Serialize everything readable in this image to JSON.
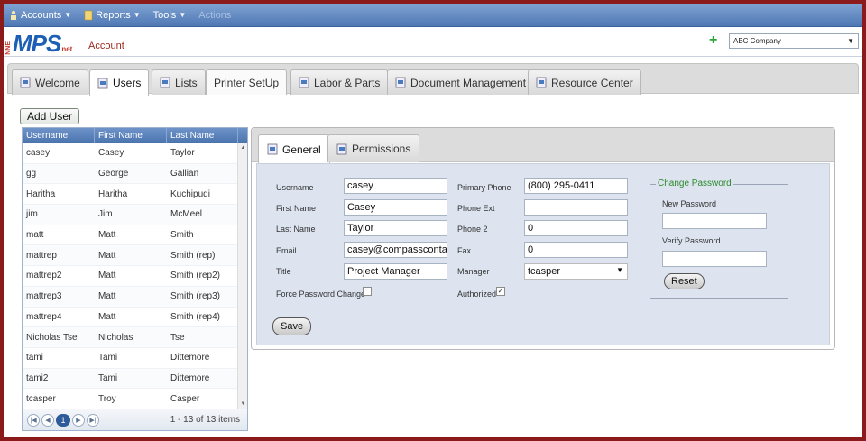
{
  "menubar": {
    "items": [
      {
        "label": "Accounts",
        "disabled": false
      },
      {
        "label": "Reports",
        "disabled": false
      },
      {
        "label": "Tools",
        "disabled": false
      },
      {
        "label": "Actions",
        "disabled": true
      }
    ]
  },
  "header": {
    "logo_main": "MPS",
    "logo_prefix": "NNE",
    "logo_suffix": "net",
    "account_link": "Account",
    "add_symbol": "+",
    "company_selected": "ABC Company"
  },
  "main_tabs": [
    "Welcome",
    "Users",
    "Lists",
    "Printer SetUp",
    "Labor & Parts",
    "Document Management",
    "Resource Center"
  ],
  "add_user_label": "Add User",
  "grid": {
    "columns": [
      "Username",
      "First Name",
      "Last Name"
    ],
    "rows": [
      [
        "casey",
        "Casey",
        "Taylor"
      ],
      [
        "gg",
        "George",
        "Gallian"
      ],
      [
        "Haritha",
        "Haritha",
        "Kuchipudi"
      ],
      [
        "jim",
        "Jim",
        "McMeel"
      ],
      [
        "matt",
        "Matt",
        "Smith"
      ],
      [
        "mattrep",
        "Matt",
        "Smith (rep)"
      ],
      [
        "mattrep2",
        "Matt",
        "Smith (rep2)"
      ],
      [
        "mattrep3",
        "Matt",
        "Smith (rep3)"
      ],
      [
        "mattrep4",
        "Matt",
        "Smith (rep4)"
      ],
      [
        "Nicholas Tse",
        "Nicholas",
        "Tse"
      ],
      [
        "tami",
        "Tami",
        "Dittemore"
      ],
      [
        "tami2",
        "Tami",
        "Dittemore"
      ],
      [
        "tcasper",
        "Troy",
        "Casper"
      ]
    ],
    "current_page": "1",
    "page_info": "1 - 13 of 13 items"
  },
  "detail": {
    "tabs": [
      "General",
      "Permissions"
    ],
    "labels": {
      "username": "Username",
      "first_name": "First Name",
      "last_name": "Last Name",
      "email": "Email",
      "title": "Title",
      "force_pw": "Force Password Change",
      "primary_phone": "Primary Phone",
      "phone_ext": "Phone Ext",
      "phone2": "Phone 2",
      "fax": "Fax",
      "manager": "Manager",
      "authorized": "Authorized"
    },
    "values": {
      "username": "casey",
      "first_name": "Casey",
      "last_name": "Taylor",
      "email": "casey@compasscontac",
      "title": "Project Manager",
      "primary_phone": "(800) 295-0411",
      "phone_ext": "",
      "phone2": "0",
      "fax": "0",
      "manager": "tcasper"
    },
    "force_pw_checked": false,
    "authorized_checked": true,
    "save_label": "Save",
    "change_password": {
      "legend": "Change Password",
      "new_label": "New Password",
      "verify_label": "Verify Password",
      "reset_label": "Reset"
    }
  },
  "colors": {
    "frame": "#8b1a1a",
    "menubar": "#5b82bd",
    "grid_header": "#5a80b9",
    "form_bg": "#dde4f0",
    "legend": "#2a8a2a"
  }
}
